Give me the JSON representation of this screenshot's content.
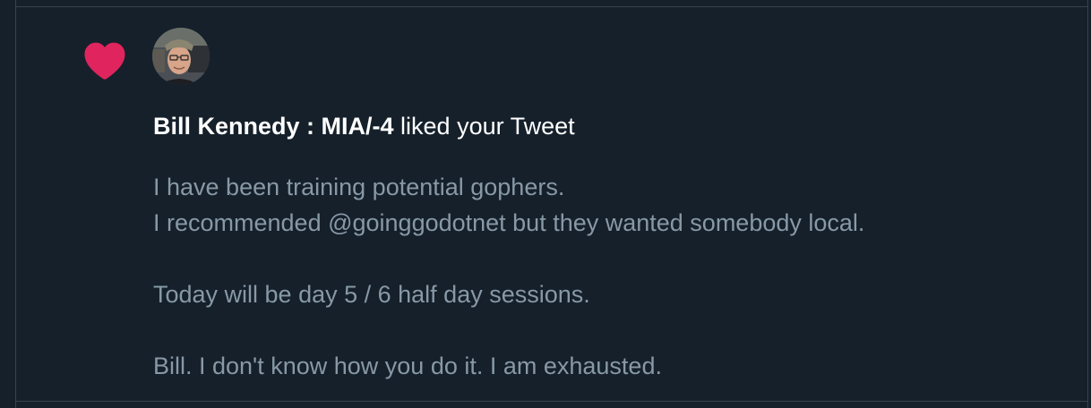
{
  "notification": {
    "actor_name": "Bill Kennedy : MIA/-4",
    "action_text": " liked your Tweet",
    "avatar_alt": "Bill Kennedy avatar",
    "icon": "heart-icon",
    "colors": {
      "background": "#15202b",
      "border": "#38444d",
      "heart": "#e0245e",
      "headline": "#ffffff",
      "tweet_text": "#8899a6"
    },
    "tweet_lines": [
      "I have been training potential gophers.",
      "I recommended @goinggodotnet but they wanted somebody local.",
      "",
      "Today will be day 5 / 6 half day sessions.",
      "",
      "Bill. I don't know how you do it. I am exhausted."
    ]
  }
}
